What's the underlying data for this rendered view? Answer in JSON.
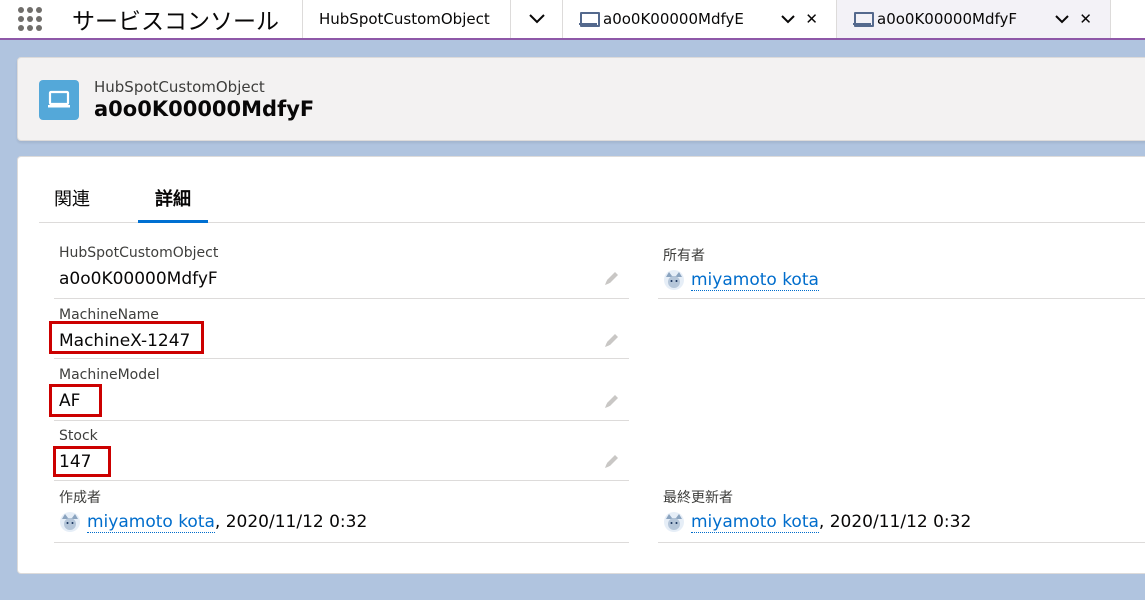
{
  "topbar": {
    "app_name": "サービスコンソール",
    "object_tab": "HubSpotCustomObject",
    "record_tabs": [
      {
        "label": "a0o0K00000MdfyE",
        "active": false
      },
      {
        "label": "a0o0K00000MdfyF",
        "active": true
      }
    ],
    "close_glyph": "✕"
  },
  "header": {
    "object_type": "HubSpotCustomObject",
    "record_name": "a0o0K00000MdfyF"
  },
  "tabs": {
    "related": "関連",
    "details": "詳細"
  },
  "fields": {
    "name": {
      "label": "HubSpotCustomObject",
      "value": "a0o0K00000MdfyF"
    },
    "owner": {
      "label": "所有者",
      "value": "miyamoto kota"
    },
    "machine_name": {
      "label": "MachineName",
      "value": "MachineX-1247"
    },
    "machine_model": {
      "label": "MachineModel",
      "value": "AF"
    },
    "stock": {
      "label": "Stock",
      "value": "147"
    },
    "created_by": {
      "label": "作成者",
      "user": "miyamoto kota",
      "date": ", 2020/11/12 0:32"
    },
    "modified_by": {
      "label": "最終更新者",
      "user": "miyamoto kota",
      "date": ", 2020/11/12 0:32"
    }
  },
  "colors": {
    "accent": "#0070d2",
    "link": "#006dcc",
    "highlight": "#cc0000",
    "icon_bg": "#54a8d9"
  }
}
